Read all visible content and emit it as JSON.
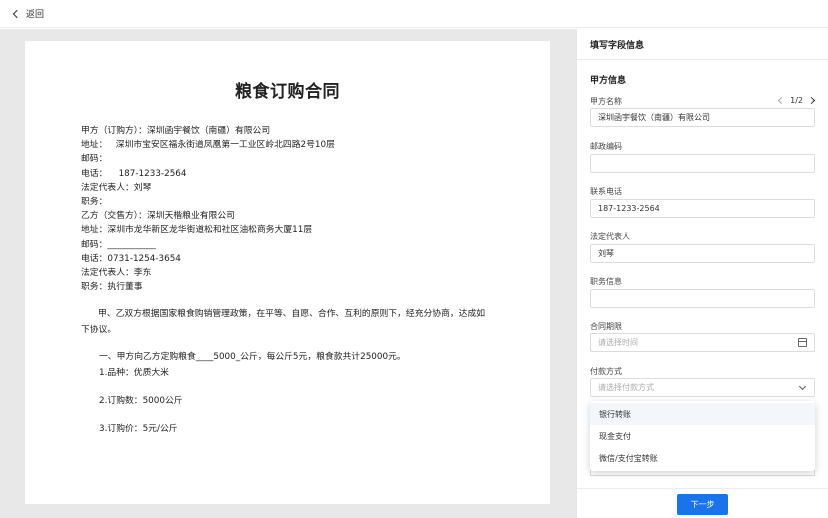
{
  "topbar": {
    "back_label": "返回"
  },
  "document": {
    "title": "粮食订购合同",
    "lines": [
      "甲方（订购方）：深圳函宇餐饮（南疆）有限公司",
      "地址：   深圳市宝安区福永街道凤凰第一工业区岭北四路2号10层",
      "邮码：",
      "电话：    187-1233-2564",
      "法定代表人：刘琴",
      "职务：",
      "乙方（交售方）：深圳天楷粮业有限公司",
      "地址：深圳市龙华新区龙华街道松和社区油松商务大厦11层",
      "邮码：___________",
      "电话：0731-1254-3654",
      "法定代表人：李东",
      "职务：执行董事"
    ],
    "paragraph": "甲、乙双方根据国家粮食购销管理政策，在平等、自愿、合作、互利的原则下，经充分协商，达成如下协议。",
    "clauses": [
      "一、甲方向乙方定购粮食____5000_公斤，每公斤5元，粮食款共计25000元。",
      "1.品种：优质大米",
      "2.订购数：5000公斤",
      "3.订购价：5元/公斤"
    ]
  },
  "panel": {
    "title": "填写字段信息",
    "section": "甲方信息",
    "pager": "1/2",
    "fields": {
      "party_a_name": {
        "label": "甲方名称",
        "value": "深圳函宇餐饮（南疆）有限公司"
      },
      "postal_code": {
        "label": "邮政编码",
        "value": ""
      },
      "phone": {
        "label": "联系电话",
        "value": "187-1233-2564"
      },
      "legal_rep": {
        "label": "法定代表人",
        "value": "刘琴"
      },
      "position": {
        "label": "职务信息",
        "value": ""
      },
      "contract_term": {
        "label": "合同期限",
        "placeholder": "请选择时间"
      },
      "payment": {
        "label": "付款方式",
        "placeholder": "请选择付款方式"
      }
    },
    "payment_options": [
      "银行转账",
      "现金支付",
      "微信/支付宝转账"
    ],
    "next_label": "下一步"
  },
  "colors": {
    "accent": "#1a73e8",
    "canvas_bg": "#e8e8e8"
  }
}
